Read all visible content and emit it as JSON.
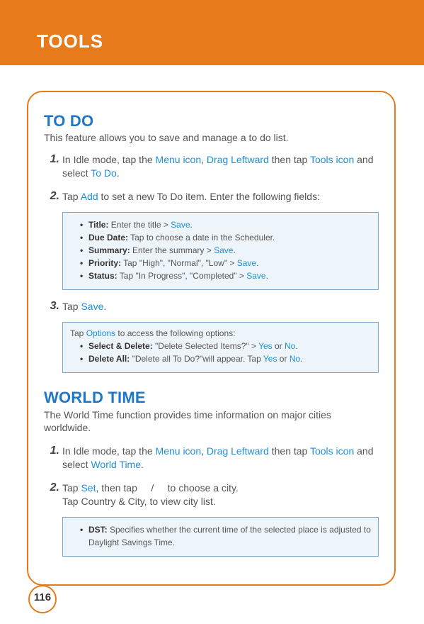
{
  "header": {
    "title": "TOOLS"
  },
  "todo": {
    "title": "TO DO",
    "subtitle": "This feature allows you to save and manage a to do list.",
    "step1": {
      "num": "1.",
      "pre": "In Idle mode, tap the ",
      "menu_icon": "Menu icon",
      "comma": ", ",
      "drag": "Drag Leftward",
      "then": " then tap ",
      "tools_icon": "Tools icon",
      "and_select": " and select ",
      "todo_link": "To Do",
      "dot": "."
    },
    "step2": {
      "num": "2.",
      "pre": "Tap ",
      "add": "Add",
      "rest": " to set a new To Do item. Enter the following fields:"
    },
    "fields": {
      "title_lbl": "Title:",
      "title_text": " Enter the title > ",
      "title_save": "Save",
      "title_dot": ".",
      "due_lbl": "Due Date:",
      "due_text": " Tap to choose a date in the Scheduler.",
      "sum_lbl": "Summary:",
      "sum_text": " Enter the summary > ",
      "sum_save": "Save",
      "sum_dot": ".",
      "pri_lbl": "Priority:",
      "pri_text": " Tap \"High\", \"Normal\", \"Low\" > ",
      "pri_save": "Save",
      "pri_dot": ".",
      "sta_lbl": "Status:",
      "sta_text": " Tap \"In Progress\", \"Completed\" > ",
      "sta_save": "Save",
      "sta_dot": "."
    },
    "step3": {
      "num": "3.",
      "pre": "Tap ",
      "save": "Save",
      "dot": "."
    },
    "options": {
      "lead_pre": "Tap ",
      "lead_opt": "Options",
      "lead_post": " to access the following options:",
      "sd_lbl": "Select & Delete:",
      "sd_text": " \"Delete Selected Items?\" > ",
      "yes1": "Yes",
      "or1": " or ",
      "no1": "No",
      "sd_dot": ".",
      "da_lbl": "Delete All:",
      "da_text": " \"Delete all To Do?\"will appear. Tap ",
      "yes2": "Yes",
      "or2": " or ",
      "no2": "No",
      "da_dot": "."
    }
  },
  "world": {
    "title": "WORLD TIME",
    "subtitle": "The World Time function provides time information on major cities worldwide.",
    "step1": {
      "num": "1.",
      "pre": "In Idle mode, tap the ",
      "menu_icon": "Menu icon",
      "comma": ", ",
      "drag": "Drag Leftward",
      "then": " then tap ",
      "tools_icon": "Tools icon",
      "and_select": " and select ",
      "wt_link": "World Time",
      "dot": "."
    },
    "step2": {
      "num": "2.",
      "pre": "Tap ",
      "set": "Set",
      "then_tap": ", then tap ",
      "slash": "/",
      "choose": " to choose a city.",
      "line2": "Tap Country & City, to view city list."
    },
    "dst": {
      "lbl": "DST:",
      "text": " Specifies whether the current time of the selected place is adjusted to Daylight Savings Time."
    }
  },
  "page_number": "116"
}
